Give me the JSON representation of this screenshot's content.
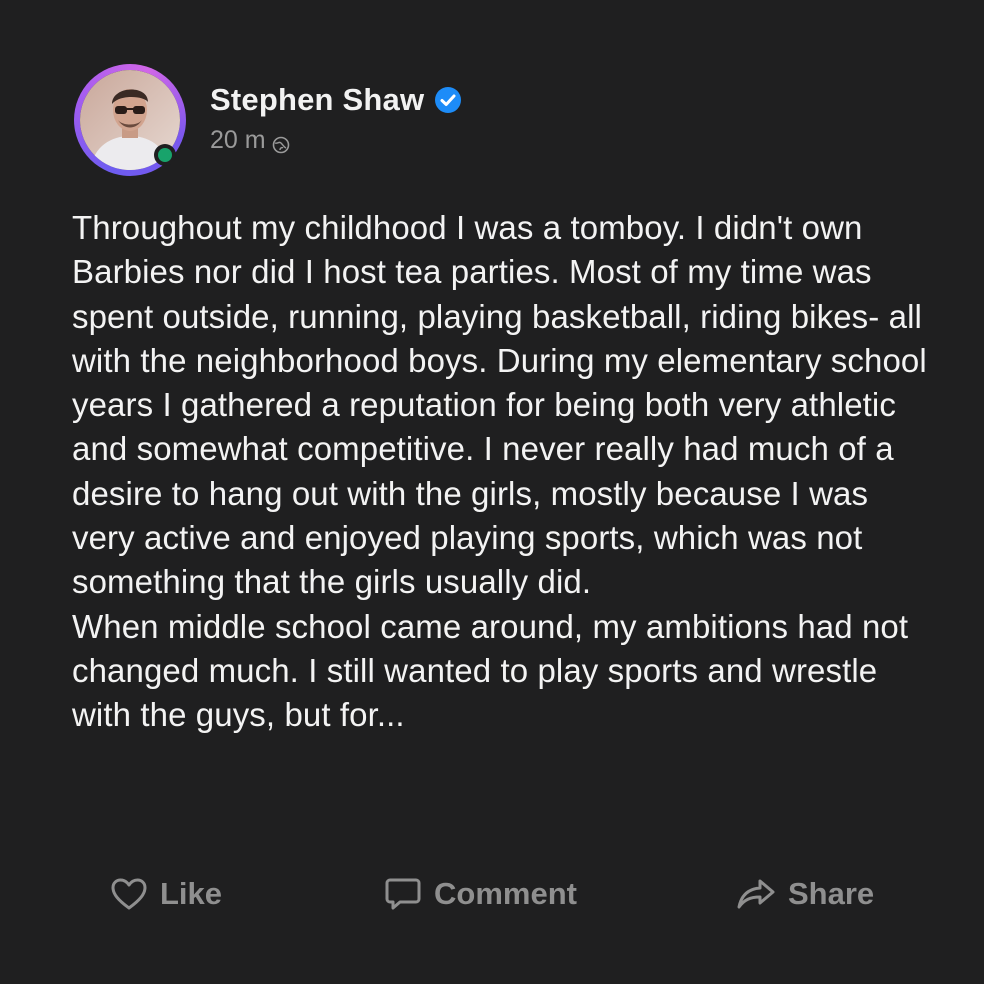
{
  "author": {
    "name": "Stephen Shaw",
    "verified": true,
    "online": true,
    "timestamp": "20 m",
    "audience_icon": "globe-icon"
  },
  "post": {
    "paragraphs": [
      "Throughout my childhood I was a tomboy. I didn't own Barbies nor did I host tea parties. Most of my time was spent outside, running, playing basketball, riding bikes- all with the neighborhood boys. During my elementary school years I gathered a reputation for being both very athletic and somewhat competitive. I never really had much of a desire to hang out with the girls, mostly because I was very active and enjoyed playing sports, which was not something that the girls usually did.",
      "When middle school came around, my ambitions had not changed much. I still wanted to play sports and wrestle with the guys, but for..."
    ]
  },
  "actions": {
    "like": {
      "label": "Like",
      "icon": "heart-outline-icon"
    },
    "comment": {
      "label": "Comment",
      "icon": "speech-bubble-icon"
    },
    "share": {
      "label": "Share",
      "icon": "share-arrow-icon"
    }
  },
  "colors": {
    "background": "#1f1f20",
    "text": "#f3f3f3",
    "muted": "#9a9a9a",
    "verified_badge": "#1d8cf8",
    "online_dot": "#18a36b",
    "avatar_ring": "#8a5cf0"
  }
}
